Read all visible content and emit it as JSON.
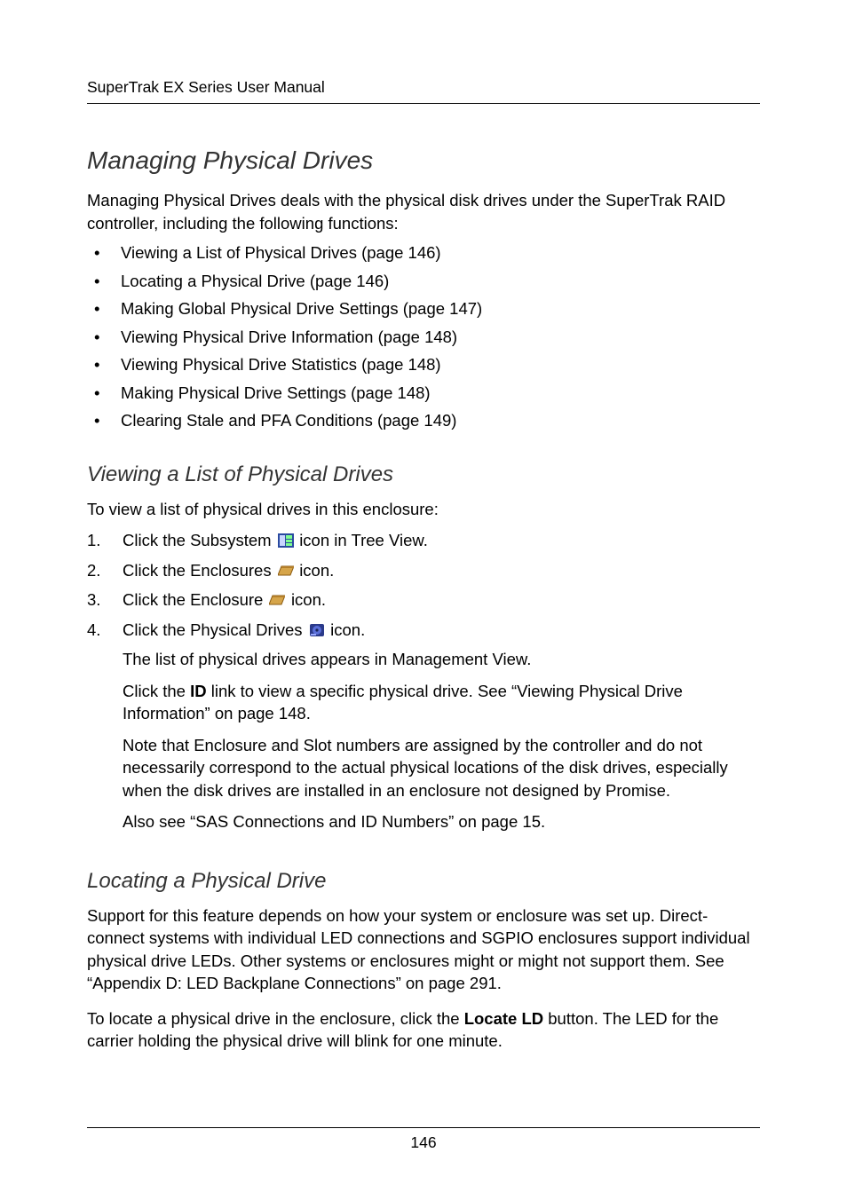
{
  "header": {
    "running_head": "SuperTrak EX Series User Manual"
  },
  "section": {
    "h1": "Managing Physical Drives",
    "intro": "Managing Physical Drives deals with the physical disk drives under the SuperTrak RAID controller, including the following functions:",
    "bullets": [
      "Viewing a List of Physical Drives (page 146)",
      "Locating a Physical Drive (page 146)",
      "Making Global Physical Drive Settings (page 147)",
      "Viewing Physical Drive Information (page 148)",
      "Viewing Physical Drive Statistics (page 148)",
      "Making Physical Drive Settings (page 148)",
      "Clearing Stale and PFA Conditions (page 149)"
    ]
  },
  "sub1": {
    "h2": "Viewing a List of Physical Drives",
    "intro": "To view a list of physical drives in this enclosure:",
    "steps": [
      {
        "pre": "Click the Subsystem ",
        "icon": "subsystem-icon",
        "post": " icon in Tree View."
      },
      {
        "pre": "Click the Enclosures ",
        "icon": "enclosures-icon",
        "post": " icon."
      },
      {
        "pre": "Click the Enclosure ",
        "icon": "enclosure-icon",
        "post": " icon."
      },
      {
        "pre": "Click the Physical Drives ",
        "icon": "physical-drives-icon",
        "post": " icon."
      }
    ],
    "after": {
      "p1": "The list of physical drives appears in Management View.",
      "p2_a": "Click the ",
      "p2_id": "ID",
      "p2_b": " link to view a specific physical drive. See “Viewing Physical Drive Information” on page 148.",
      "p3": "Note that Enclosure and Slot numbers are assigned by the controller and do not necessarily correspond to the actual physical locations of the disk drives, especially when the disk drives are installed in an enclosure not designed by Promise.",
      "p4": "Also see “SAS Connections and ID Numbers” on page 15."
    }
  },
  "sub2": {
    "h2": "Locating a Physical Drive",
    "p1": "Support for this feature depends on how your system or enclosure was set up. Direct-connect systems with individual LED connections and SGPIO enclosures support individual physical drive LEDs. Other systems or enclosures might or might not support them. See “Appendix D: LED Backplane Connections” on page 291.",
    "p2_a": "To locate a physical drive in the enclosure, click the ",
    "p2_btn": "Locate LD",
    "p2_b": " button. The LED for the carrier holding the physical drive will blink for one minute."
  },
  "footer": {
    "page_number": "146"
  },
  "icons": {
    "subsystem": "subsystem-icon",
    "enclosures": "enclosures-icon",
    "enclosure": "enclosure-icon",
    "physical_drives": "physical-drives-icon"
  }
}
